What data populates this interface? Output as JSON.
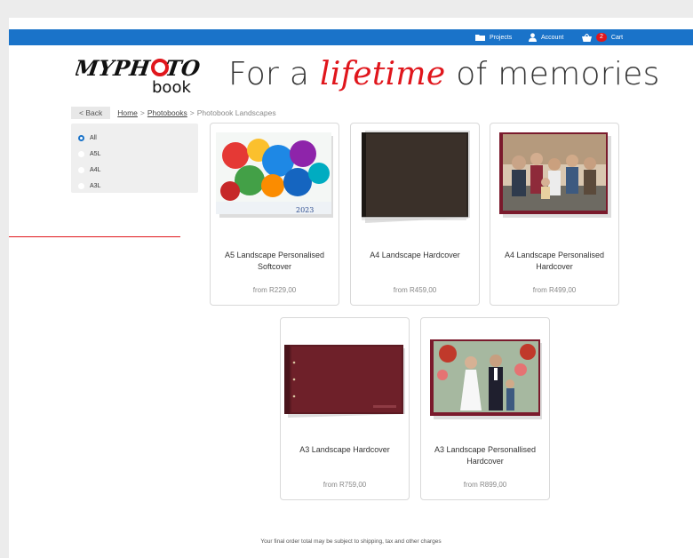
{
  "topbar": {
    "projects_label": "Projects",
    "account_label": "Account",
    "cart_count": "2",
    "cart_label": "Cart"
  },
  "header": {
    "logo_text_top": "MYPHOTO",
    "logo_text_bottom": "book",
    "tagline_before": "For a ",
    "tagline_script": "lifetime",
    "tagline_after": " of memories"
  },
  "breadcrumb": {
    "back_label": "< Back",
    "home": "Home",
    "sep1": ">",
    "photobooks": "Photobooks",
    "sep2": ">",
    "current": "Photobook Landscapes"
  },
  "filters": {
    "options": [
      {
        "label": "All",
        "selected": true
      },
      {
        "label": "A5L",
        "selected": false
      },
      {
        "label": "A4L",
        "selected": false
      },
      {
        "label": "A3L",
        "selected": false
      }
    ]
  },
  "products": [
    {
      "title": "A5 Landscape Personalised Softcover",
      "price": "from R229,00",
      "image": "handprints-cover"
    },
    {
      "title": "A4 Landscape Hardcover",
      "price": "from R459,00",
      "image": "brown-hardcover"
    },
    {
      "title": "A4 Landscape Personalised Hardcover",
      "price": "from R499,00",
      "image": "family-photo-cover"
    },
    {
      "title": "A3 Landscape Hardcover",
      "price": "from R759,00",
      "image": "maroon-hardcover"
    },
    {
      "title": "A3 Landscape Personallised Hardcover",
      "price": "from R899,00",
      "image": "wedding-photo-cover"
    }
  ],
  "footer": {
    "note": "Your final order total may be subject to shipping, tax and other charges"
  },
  "colors": {
    "brand_blue": "#1a73c9",
    "accent_red": "#e0161c"
  }
}
